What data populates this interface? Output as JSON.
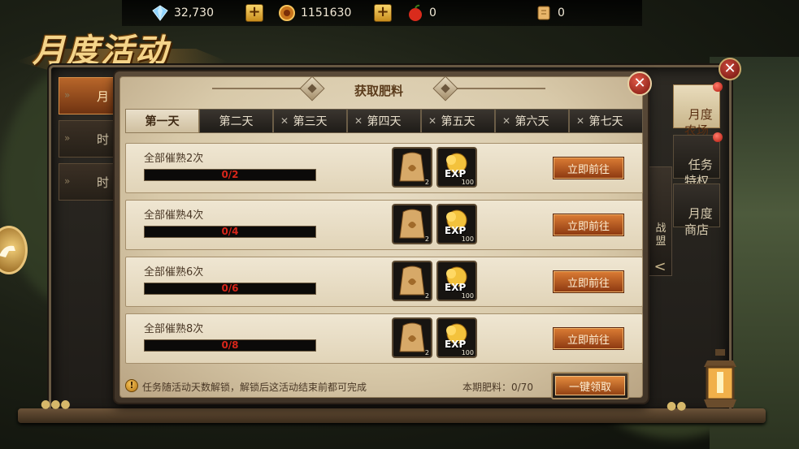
{
  "topbar": {
    "diamonds": "32,730",
    "gold": "1151630",
    "apples": "0",
    "scrolls": "0",
    "plus_label": "+"
  },
  "logo": {
    "title": "月度活动"
  },
  "left_tabs": [
    {
      "label": "月",
      "active": true
    },
    {
      "label": "时",
      "active": false
    },
    {
      "label": "时",
      "active": false
    }
  ],
  "right_tabs": [
    {
      "label": "月度\n农场",
      "active": true,
      "badge": true
    },
    {
      "label": "任务\n特权",
      "active": false,
      "badge": true
    },
    {
      "label": "月度\n商店",
      "active": false,
      "badge": false
    }
  ],
  "side_strip": {
    "label": "战盟",
    "arrow": "<"
  },
  "panel": {
    "title": "获取肥料",
    "close": "✕",
    "tabs": [
      {
        "label": "第一天",
        "locked": false,
        "active": true
      },
      {
        "label": "第二天",
        "locked": false,
        "active": false
      },
      {
        "label": "第三天",
        "locked": true,
        "active": false
      },
      {
        "label": "第四天",
        "locked": true,
        "active": false
      },
      {
        "label": "第五天",
        "locked": true,
        "active": false
      },
      {
        "label": "第六天",
        "locked": true,
        "active": false
      },
      {
        "label": "第七天",
        "locked": true,
        "active": false
      }
    ],
    "tasks": [
      {
        "label": "全部催熟2次",
        "progress": "0/2",
        "progress_fraction": 0,
        "reward1_qty": "2",
        "reward2_qty": "100",
        "reward2_label": "EXP",
        "button": "立即前往"
      },
      {
        "label": "全部催熟4次",
        "progress": "0/4",
        "progress_fraction": 0,
        "reward1_qty": "2",
        "reward2_qty": "100",
        "reward2_label": "EXP",
        "button": "立即前往"
      },
      {
        "label": "全部催熟6次",
        "progress": "0/6",
        "progress_fraction": 0,
        "reward1_qty": "2",
        "reward2_qty": "100",
        "reward2_label": "EXP",
        "button": "立即前往"
      },
      {
        "label": "全部催熟8次",
        "progress": "0/8",
        "progress_fraction": 0,
        "reward1_qty": "2",
        "reward2_qty": "100",
        "reward2_label": "EXP",
        "button": "立即前往"
      }
    ],
    "footer": {
      "notice": "任务随活动天数解锁，解锁后这活动结束前都可完成",
      "fertilizer": "本期肥料：0/70",
      "claim_button": "一键领取"
    }
  },
  "colors": {
    "accent_orange": "#d97a33",
    "progress_red": "#d8261a",
    "parchment": "#e7dcc4"
  },
  "icons": [
    "diamond-icon",
    "gold-coin-icon",
    "apple-icon",
    "scroll-icon",
    "fertilizer-bag-icon",
    "exp-coins-icon",
    "lock-icon",
    "warning-icon",
    "close-icon"
  ]
}
